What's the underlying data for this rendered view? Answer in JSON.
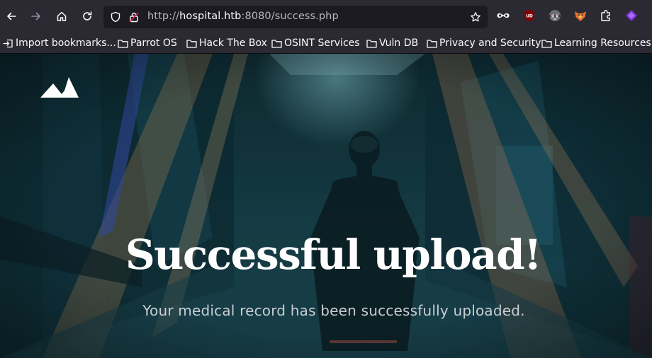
{
  "browser": {
    "url_prefix": "http://",
    "url_host": "hospital.htb",
    "url_rest": ":8080/success.php",
    "icons": {
      "back": "arrow-left-icon",
      "forward": "arrow-right-icon",
      "home": "home-icon",
      "reload": "reload-icon",
      "shield": "tracking-shield-icon",
      "insecure": "insecure-lock-icon",
      "bookmark_star": "star-icon",
      "extensions": [
        "mask-icon",
        "ublock-icon",
        "privacy-badger-icon",
        "foxyproxy-icon",
        "puzzle-icon",
        "purple-extension-icon"
      ]
    }
  },
  "bookmarks": [
    {
      "label": "Import bookmarks...",
      "icon": "import-icon"
    },
    {
      "label": "Parrot OS",
      "icon": "folder-icon"
    },
    {
      "label": "Hack The Box",
      "icon": "folder-icon"
    },
    {
      "label": "OSINT Services",
      "icon": "folder-icon"
    },
    {
      "label": "Vuln DB",
      "icon": "folder-icon"
    },
    {
      "label": "Privacy and Security",
      "icon": "folder-icon"
    },
    {
      "label": "Learning Resources",
      "icon": "folder-icon"
    }
  ],
  "page": {
    "logo": "mountain-logo-icon",
    "headline": "Successful upload!",
    "subline": "Your medical record has been successfully uploaded."
  },
  "colors": {
    "toolbar_bg": "#2b2a33",
    "urlbar_bg": "#1c1b22",
    "hero_tint": "#163540"
  }
}
